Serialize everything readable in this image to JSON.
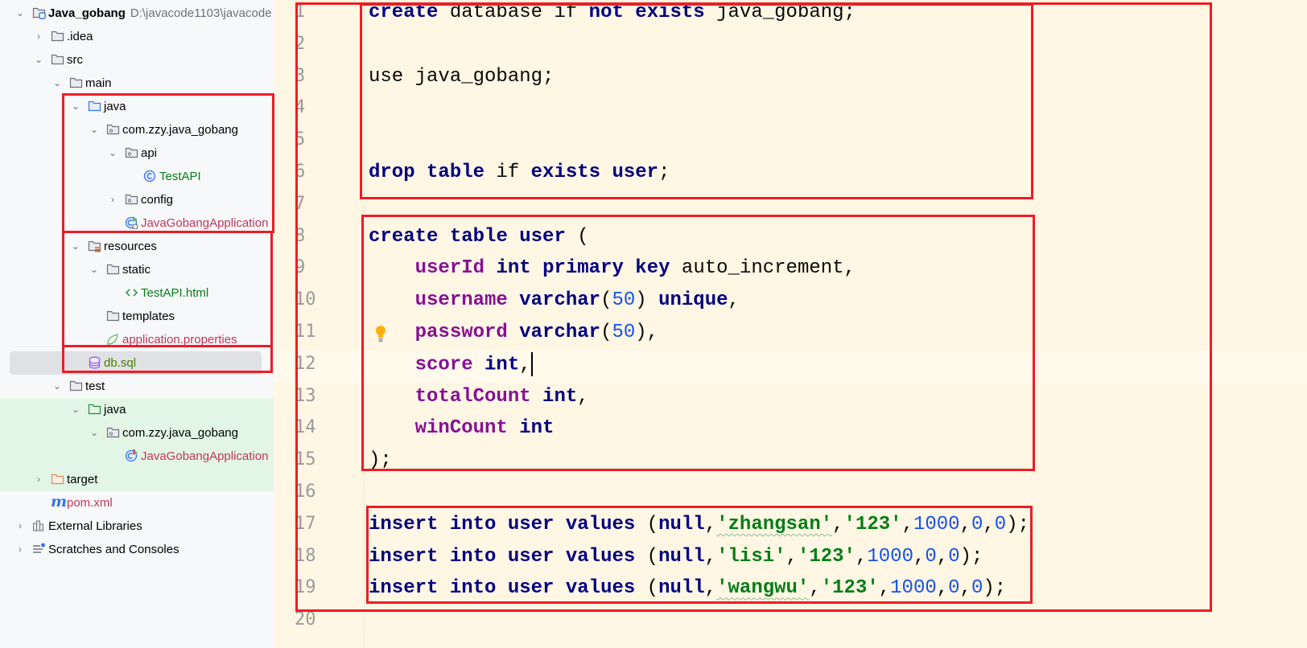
{
  "project_tree": {
    "items": [
      {
        "label": "Java_gobang",
        "path": "D:\\javacode1103\\javacode",
        "level": 0,
        "chevron": "expanded",
        "icon": "module-folder-icon",
        "color": "#000000",
        "bold": true
      },
      {
        "label": ".idea",
        "level": 1,
        "chevron": "collapsed",
        "icon": "folder-icon",
        "color": "#000000"
      },
      {
        "label": "src",
        "level": 1,
        "chevron": "expanded",
        "icon": "folder-icon",
        "color": "#000000"
      },
      {
        "label": "main",
        "level": 2,
        "chevron": "expanded",
        "icon": "folder-icon",
        "color": "#000000"
      },
      {
        "label": "java",
        "level": 3,
        "chevron": "expanded",
        "icon": "source-folder-icon",
        "color": "#000000"
      },
      {
        "label": "com.zzy.java_gobang",
        "level": 4,
        "chevron": "expanded",
        "icon": "package-icon",
        "color": "#000000"
      },
      {
        "label": "api",
        "level": 5,
        "chevron": "expanded",
        "icon": "package-icon",
        "color": "#000000"
      },
      {
        "label": "TestAPI",
        "level": 6,
        "chevron": "none",
        "icon": "class-icon",
        "color": "#067d17"
      },
      {
        "label": "config",
        "level": 5,
        "chevron": "collapsed",
        "icon": "package-icon",
        "color": "#000000"
      },
      {
        "label": "JavaGobangApplication",
        "level": 5,
        "chevron": "none",
        "icon": "spring-boot-class-icon",
        "color": "#c0365a"
      },
      {
        "label": "resources",
        "level": 3,
        "chevron": "expanded",
        "icon": "resources-folder-icon",
        "color": "#000000"
      },
      {
        "label": "static",
        "level": 4,
        "chevron": "expanded",
        "icon": "folder-icon",
        "color": "#000000"
      },
      {
        "label": "TestAPI.html",
        "level": 5,
        "chevron": "none",
        "icon": "html-icon",
        "color": "#067d17"
      },
      {
        "label": "templates",
        "level": 4,
        "chevron": "none",
        "icon": "folder-icon",
        "color": "#000000"
      },
      {
        "label": "application.properties",
        "level": 4,
        "chevron": "none",
        "icon": "spring-properties-icon",
        "color": "#c0365a"
      },
      {
        "label": "db.sql",
        "level": 3,
        "chevron": "none",
        "icon": "database-icon",
        "color": "#4b7d00",
        "selected": true
      },
      {
        "label": "test",
        "level": 2,
        "chevron": "expanded",
        "icon": "folder-icon",
        "color": "#000000"
      },
      {
        "label": "java",
        "level": 3,
        "chevron": "expanded",
        "icon": "test-folder-icon",
        "color": "#000000",
        "testbg": true
      },
      {
        "label": "com.zzy.java_gobang",
        "level": 4,
        "chevron": "expanded",
        "icon": "package-icon",
        "color": "#000000",
        "testbg": true
      },
      {
        "label": "JavaGobangApplication",
        "level": 5,
        "chevron": "none",
        "icon": "test-class-icon",
        "color": "#c0365a",
        "testbg": true
      },
      {
        "label": "target",
        "level": 1,
        "chevron": "collapsed",
        "icon": "excluded-folder-icon",
        "color": "#000000",
        "testbg": true
      },
      {
        "label": "pom.xml",
        "level": 1,
        "chevron": "none",
        "icon": "maven-icon",
        "color": "#c0365a"
      },
      {
        "label": "External Libraries",
        "level": 0,
        "chevron": "collapsed",
        "icon": "libraries-icon",
        "color": "#000000"
      },
      {
        "label": "Scratches and Consoles",
        "level": 0,
        "chevron": "collapsed",
        "icon": "scratches-icon",
        "color": "#000000"
      }
    ]
  },
  "editor": {
    "current_line": 12,
    "intention_bulb_line": 11,
    "lines": [
      [
        [
          "create",
          "kw"
        ],
        [
          " database ",
          "plain"
        ],
        [
          "if",
          "plain"
        ],
        [
          " ",
          "plain"
        ],
        [
          "not",
          "kw"
        ],
        [
          " ",
          "plain"
        ],
        [
          "exists",
          "kw"
        ],
        [
          " java_gobang;",
          "plain"
        ]
      ],
      [],
      [
        [
          "use java_gobang;",
          "plain"
        ]
      ],
      [],
      [],
      [
        [
          "drop",
          "kw"
        ],
        [
          " ",
          "plain"
        ],
        [
          "table",
          "kw"
        ],
        [
          " if ",
          "plain"
        ],
        [
          "exists",
          "kw"
        ],
        [
          " ",
          "plain"
        ],
        [
          "user",
          "kw"
        ],
        [
          ";",
          "plain"
        ]
      ],
      [],
      [
        [
          "create",
          "kw"
        ],
        [
          " ",
          "plain"
        ],
        [
          "table",
          "kw"
        ],
        [
          " ",
          "plain"
        ],
        [
          "user",
          "kw"
        ],
        [
          " (",
          "plain"
        ]
      ],
      [
        [
          "    ",
          "plain"
        ],
        [
          "userId",
          "col"
        ],
        [
          " ",
          "plain"
        ],
        [
          "int",
          "kw"
        ],
        [
          " ",
          "plain"
        ],
        [
          "primary",
          "kw"
        ],
        [
          " ",
          "plain"
        ],
        [
          "key",
          "kw"
        ],
        [
          " auto_increment,",
          "plain"
        ]
      ],
      [
        [
          "    ",
          "plain"
        ],
        [
          "username",
          "col"
        ],
        [
          " ",
          "plain"
        ],
        [
          "varchar",
          "kw"
        ],
        [
          "(",
          "plain"
        ],
        [
          "50",
          "num"
        ],
        [
          ") ",
          "plain"
        ],
        [
          "unique",
          "kw"
        ],
        [
          ",",
          "plain"
        ]
      ],
      [
        [
          "    ",
          "plain"
        ],
        [
          "password",
          "col"
        ],
        [
          " ",
          "plain"
        ],
        [
          "varchar",
          "kw"
        ],
        [
          "(",
          "plain"
        ],
        [
          "50",
          "num"
        ],
        [
          "),",
          "plain"
        ]
      ],
      [
        [
          "    ",
          "plain"
        ],
        [
          "score",
          "col"
        ],
        [
          " ",
          "plain"
        ],
        [
          "int",
          "kw"
        ],
        [
          ",",
          "plain"
        ]
      ],
      [
        [
          "    ",
          "plain"
        ],
        [
          "totalCount",
          "col"
        ],
        [
          " ",
          "plain"
        ],
        [
          "int",
          "kw"
        ],
        [
          ",",
          "plain"
        ]
      ],
      [
        [
          "    ",
          "plain"
        ],
        [
          "winCount",
          "col"
        ],
        [
          " ",
          "plain"
        ],
        [
          "int",
          "kw"
        ]
      ],
      [
        [
          ");",
          "plain"
        ]
      ],
      [],
      [
        [
          "insert",
          "kw"
        ],
        [
          " ",
          "plain"
        ],
        [
          "into",
          "kw"
        ],
        [
          " ",
          "plain"
        ],
        [
          "user",
          "kw"
        ],
        [
          " ",
          "plain"
        ],
        [
          "values",
          "kw"
        ],
        [
          " (",
          "plain"
        ],
        [
          "null",
          "kw"
        ],
        [
          ",",
          "plain"
        ],
        [
          "'zhangsan'",
          "str"
        ],
        [
          ",",
          "plain"
        ],
        [
          "'123'",
          "str"
        ],
        [
          ",",
          "plain"
        ],
        [
          "1000",
          "num"
        ],
        [
          ",",
          "plain"
        ],
        [
          "0",
          "num"
        ],
        [
          ",",
          "plain"
        ],
        [
          "0",
          "num"
        ],
        [
          ");",
          "plain"
        ]
      ],
      [
        [
          "insert",
          "kw"
        ],
        [
          " ",
          "plain"
        ],
        [
          "into",
          "kw"
        ],
        [
          " ",
          "plain"
        ],
        [
          "user",
          "kw"
        ],
        [
          " ",
          "plain"
        ],
        [
          "values",
          "kw"
        ],
        [
          " (",
          "plain"
        ],
        [
          "null",
          "kw"
        ],
        [
          ",",
          "plain"
        ],
        [
          "'lisi'",
          "str"
        ],
        [
          ",",
          "plain"
        ],
        [
          "'123'",
          "str"
        ],
        [
          ",",
          "plain"
        ],
        [
          "1000",
          "num"
        ],
        [
          ",",
          "plain"
        ],
        [
          "0",
          "num"
        ],
        [
          ",",
          "plain"
        ],
        [
          "0",
          "num"
        ],
        [
          ");",
          "plain"
        ]
      ],
      [
        [
          "insert",
          "kw"
        ],
        [
          " ",
          "plain"
        ],
        [
          "into",
          "kw"
        ],
        [
          " ",
          "plain"
        ],
        [
          "user",
          "kw"
        ],
        [
          " ",
          "plain"
        ],
        [
          "values",
          "kw"
        ],
        [
          " (",
          "plain"
        ],
        [
          "null",
          "kw"
        ],
        [
          ",",
          "plain"
        ],
        [
          "'wangwu'",
          "str"
        ],
        [
          ",",
          "plain"
        ],
        [
          "'123'",
          "str"
        ],
        [
          ",",
          "plain"
        ],
        [
          "1000",
          "num"
        ],
        [
          ",",
          "plain"
        ],
        [
          "0",
          "num"
        ],
        [
          ",",
          "plain"
        ],
        [
          "0",
          "num"
        ],
        [
          ");",
          "plain"
        ]
      ],
      []
    ]
  },
  "colors": {
    "highlight_box": "#ee1c25",
    "keyword": "#000080",
    "column": "#871094",
    "number": "#1750eb",
    "string": "#067d17",
    "editor_bg": "#fff7e4"
  }
}
